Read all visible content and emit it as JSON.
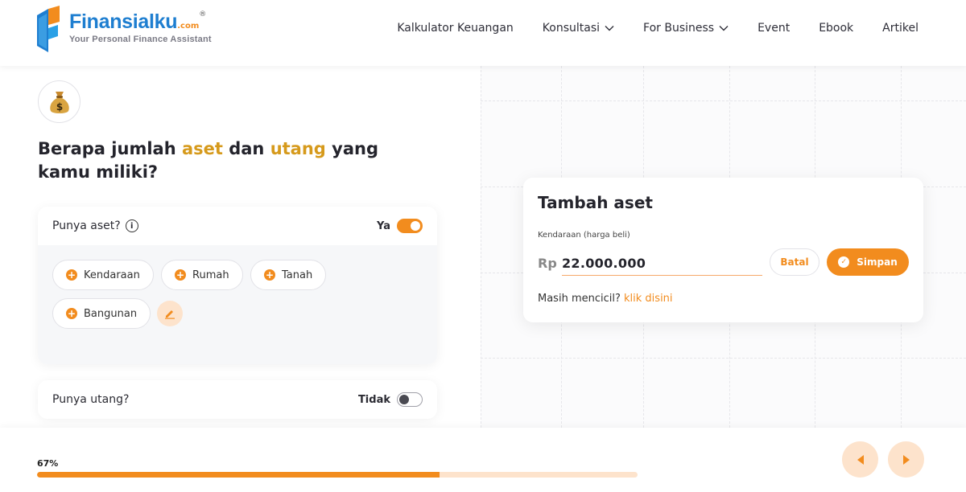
{
  "header": {
    "logo_name": "Finansialku",
    "logo_com": ".com",
    "logo_reg": "®",
    "logo_tagline": "Your Personal Finance Assistant",
    "nav": [
      {
        "label": "Kalkulator Keuangan",
        "dropdown": false
      },
      {
        "label": "Konsultasi",
        "dropdown": true
      },
      {
        "label": "For Business",
        "dropdown": true
      },
      {
        "label": "Event",
        "dropdown": false
      },
      {
        "label": "Ebook",
        "dropdown": false
      },
      {
        "label": "Artikel",
        "dropdown": false
      }
    ]
  },
  "question": {
    "part1": "Berapa jumlah ",
    "highlight1": "aset",
    "part2": " dan ",
    "highlight2": "utang",
    "part3": " yang kamu miliki?"
  },
  "aset_card": {
    "title": "Punya aset?",
    "info_icon": "i",
    "toggle_label": "Ya",
    "toggle_on": true,
    "chips": [
      "Kendaraan",
      "Rumah",
      "Tanah",
      "Bangunan"
    ]
  },
  "utang_card": {
    "title": "Punya utang?",
    "toggle_label": "Tidak",
    "toggle_on": false
  },
  "modal": {
    "title": "Tambah aset",
    "field_label": "Kendaraan (harga beli)",
    "currency": "Rp",
    "amount": "22.000.000",
    "cancel_label": "Batal",
    "save_label": "Simpan",
    "mencicil_text": "Masih mencicil?",
    "mencicil_link": "klik disini"
  },
  "progress": {
    "label": "67%",
    "value": 0.67
  },
  "colors": {
    "accent": "#f28c1e",
    "accent_light": "#fde3cc",
    "highlight": "#d69a1c",
    "brand_blue": "#1e7ed0"
  }
}
